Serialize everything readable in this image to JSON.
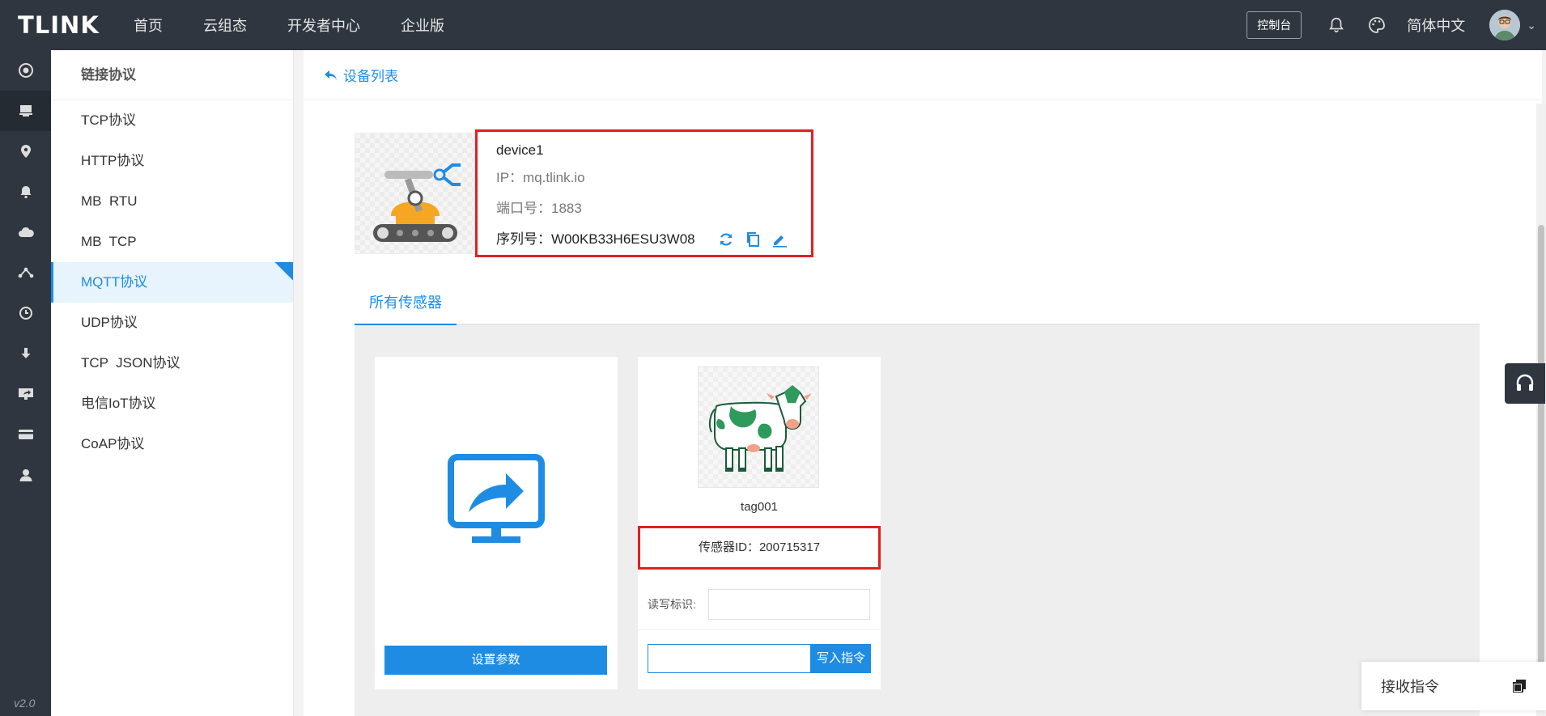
{
  "brand": "TLINK",
  "topnav": [
    "首页",
    "云组态",
    "开发者中心",
    "企业版"
  ],
  "topright": {
    "console": "控制台",
    "language": "简体中文"
  },
  "version": "v2.0",
  "sidebar": {
    "title": "链接协议",
    "items": [
      "TCP协议",
      "HTTP协议",
      "MB  RTU",
      "MB  TCP",
      "MQTT协议",
      "UDP协议",
      "TCP  JSON协议",
      "电信IoT协议",
      "CoAP协议"
    ],
    "active_index": 4
  },
  "breadcrumb": "设备列表",
  "device": {
    "name": "device1",
    "ip": "IP：mq.tlink.io",
    "port": "端口号：1883",
    "serial": "序列号：W00KB33H6ESU3W08"
  },
  "tabs": [
    "所有传感器"
  ],
  "cards": {
    "set_param": "设置参数",
    "sensor": {
      "tag": "tag001",
      "sensor_id": "传感器ID：200715317",
      "rw_label": "读写标识:",
      "write_button": "写入指令"
    }
  },
  "receive": "接收指令",
  "colors": {
    "accent": "#1f8ce3",
    "dark": "#2f3640",
    "highlight": "#e02020"
  }
}
